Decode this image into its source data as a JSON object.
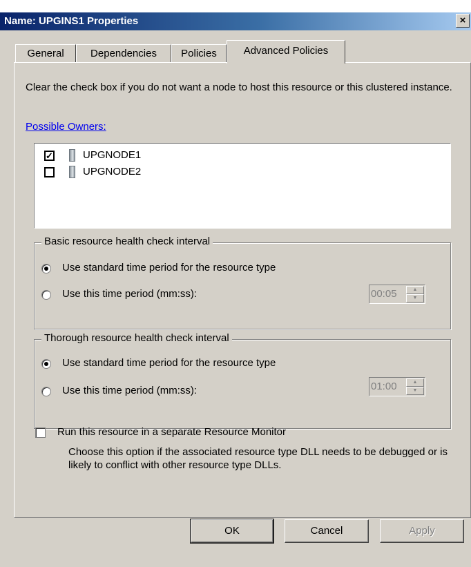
{
  "window": {
    "title": "Name: UPGINS1 Properties",
    "close_glyph": "×",
    "top_fragment": ""
  },
  "tabs": [
    {
      "label": "General",
      "active": false
    },
    {
      "label": "Dependencies",
      "active": false
    },
    {
      "label": "Policies",
      "active": false
    },
    {
      "label": "Advanced Policies",
      "active": true
    }
  ],
  "advanced": {
    "description": "Clear the check box if you do not want a node to host this resource or this clustered instance.",
    "owners_link": "Possible Owners:",
    "owners": [
      {
        "name": "UPGNODE1",
        "checked": true,
        "check_glyph": "✓",
        "icon": "server-icon"
      },
      {
        "name": "UPGNODE2",
        "checked": false,
        "check_glyph": "",
        "icon": "server-icon"
      }
    ],
    "basic": {
      "label": "Basic resource health check interval",
      "standard_label": "Use standard time period for the resource type",
      "custom_label": "Use this time period (mm:ss):",
      "selected": "standard",
      "value": "00:05"
    },
    "thorough": {
      "label": "Thorough resource health check interval",
      "standard_label": "Use standard time period for the resource type",
      "custom_label": "Use this time period (mm:ss):",
      "selected": "standard",
      "value": "01:00"
    },
    "separate_monitor": {
      "label": "Run this resource in a separate Resource Monitor",
      "checked": false,
      "note": "Choose this option if the associated resource type DLL needs to be debugged or is likely to conflict with other resource type DLLs."
    }
  },
  "buttons": {
    "ok": "OK",
    "cancel": "Cancel",
    "apply": "Apply"
  },
  "colors": {
    "titlebar": "#0a246a",
    "face": "#d4d0c8",
    "link": "#0000ee"
  }
}
